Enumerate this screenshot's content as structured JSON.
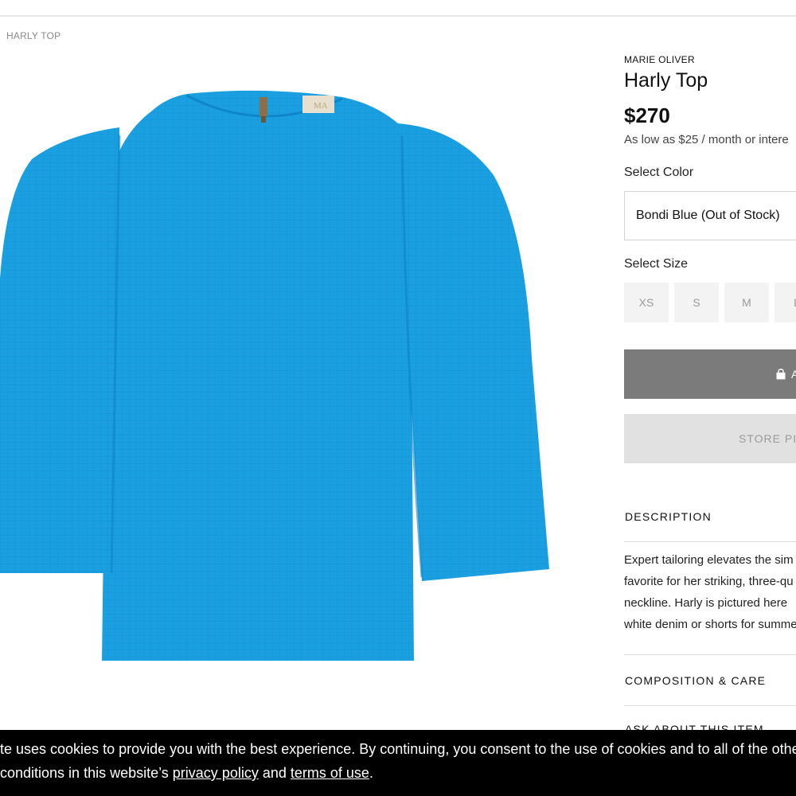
{
  "breadcrumb": "HARLY TOP",
  "product": {
    "brand": "MARIE OLIVER",
    "title": "Harly Top",
    "price": "$270",
    "financing": "As low as $25 / month or intere",
    "garment_color": "#1a9fe0",
    "image_label": "MA"
  },
  "color": {
    "label": "Select Color",
    "selected": "Bondi Blue (Out of Stock)"
  },
  "size": {
    "label": "Select Size",
    "options": [
      "XS",
      "S",
      "M",
      "L"
    ]
  },
  "buttons": {
    "add_partial": "A",
    "store_pickup_partial": "STORE PIC",
    "add_color": "#7b7b7b",
    "store_color": "#e1e1e1"
  },
  "description": {
    "heading": "DESCRIPTION",
    "lines": [
      "Expert tailoring elevates the sim",
      "favorite for her striking, three-qu",
      "neckline. Harly is pictured here",
      "white denim or shorts for summe"
    ]
  },
  "composition_heading": "COMPOSITION & CARE",
  "ask_heading": "ASK ABOUT THIS ITEM",
  "cookie": {
    "line1": "te uses cookies to provide you with the best experience. By continuing, you consent to the use of cookies and to all of the other",
    "line2_prefix": " conditions in this website’s ",
    "privacy_link": "privacy policy",
    "and": " and ",
    "terms_link": "terms of use",
    "period": "."
  }
}
